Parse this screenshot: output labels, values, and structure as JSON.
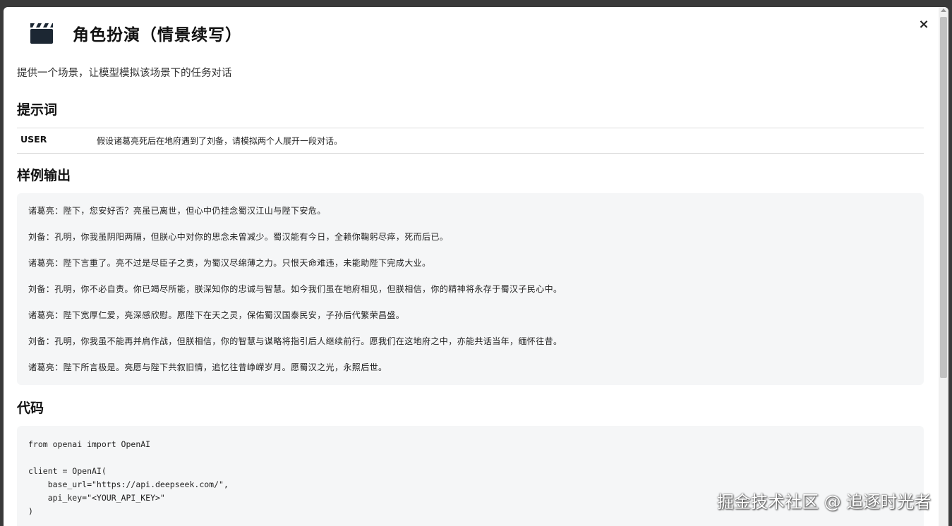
{
  "header": {
    "icon": "clapperboard-icon",
    "title": "角色扮演（情景续写）"
  },
  "description": "提供一个场景，让模型模拟该场景下的任务对话",
  "sections": {
    "prompt_heading": "提示词",
    "sample_heading": "样例输出",
    "code_heading": "代码"
  },
  "prompt": {
    "role": "USER",
    "text": "假设诸葛亮死后在地府遇到了刘备，请模拟两个人展开一段对话。"
  },
  "sample_output": [
    "诸葛亮：陛下，您安好否？亮虽已离世，但心中仍挂念蜀汉江山与陛下安危。",
    "刘备：孔明，你我虽阴阳两隔，但朕心中对你的思念未曾减少。蜀汉能有今日，全赖你鞠躬尽瘁，死而后已。",
    "诸葛亮：陛下言重了。亮不过是尽臣子之责，为蜀汉尽绵薄之力。只恨天命难违，未能助陛下完成大业。",
    "刘备：孔明，你不必自责。你已竭尽所能，朕深知你的忠诚与智慧。如今我们虽在地府相见，但朕相信，你的精神将永存于蜀汉子民心中。",
    "诸葛亮：陛下宽厚仁爱，亮深感欣慰。愿陛下在天之灵，保佑蜀汉国泰民安，子孙后代繁荣昌盛。",
    "刘备：孔明，你我虽不能再并肩作战，但朕相信，你的智慧与谋略将指引后人继续前行。愿我们在这地府之中，亦能共话当年，缅怀往昔。",
    "诸葛亮：陛下所言极是。亮愿与陛下共叙旧情，追忆往昔峥嵘岁月。愿蜀汉之光，永照后世。"
  ],
  "code_lines": [
    "from openai import OpenAI",
    "",
    "client = OpenAI(",
    "    base_url=\"https://api.deepseek.com/\",",
    "    api_key=\"<YOUR_API_KEY>\"",
    ")"
  ],
  "close_label": "×",
  "watermark": "掘金技术社区 @ 追逐时光者"
}
